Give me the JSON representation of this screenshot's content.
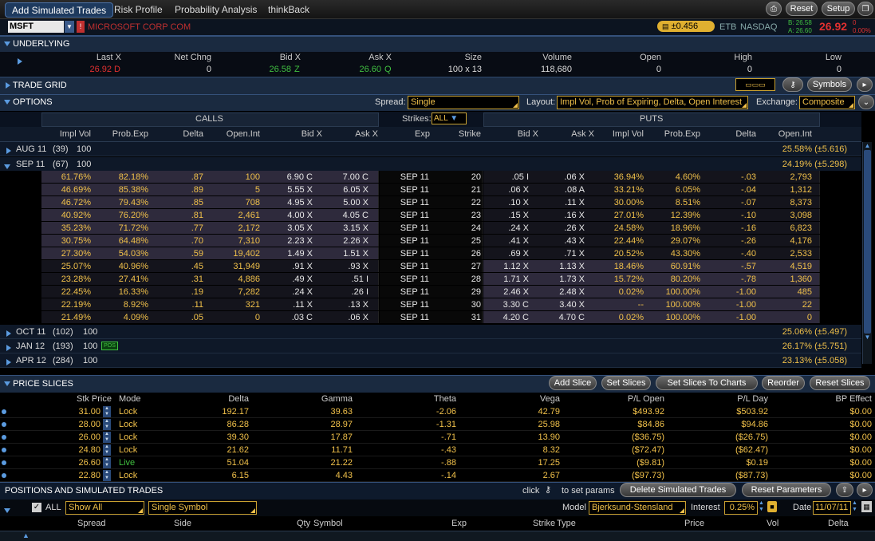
{
  "tabs": [
    "Add Simulated Trades",
    "Risk Profile",
    "Probability Analysis",
    "thinkBack"
  ],
  "top_buttons": {
    "reset": "Reset",
    "setup": "Setup"
  },
  "symbol": {
    "ticker": "MSFT",
    "company": "MICROSOFT CORP COM",
    "change": "±0.456",
    "etb": "ETB",
    "exchange": "NASDAQ",
    "bid_small": "B: 26.58",
    "ask_small": "A: 26.60",
    "last": "26.92",
    "chg_small": "0",
    "pct_small": "0.00%"
  },
  "underlying": {
    "title": "UNDERLYING",
    "headers": [
      "Last X",
      "Net Chng",
      "Bid X",
      "Ask X",
      "Size",
      "Volume",
      "Open",
      "High",
      "Low"
    ],
    "values": [
      "26.92",
      "0",
      "26.58",
      "26.60",
      "100 x 13",
      "118,680",
      "0",
      "0",
      "0"
    ],
    "last_ex": "D",
    "bid_ex": "Z",
    "ask_ex": "Q"
  },
  "trade_grid": {
    "title": "TRADE GRID",
    "symbols_label": "Symbols"
  },
  "options": {
    "title": "OPTIONS",
    "spread_label": "Spread:",
    "spread_value": "Single",
    "layout_label": "Layout:",
    "layout_value": "Impl Vol, Prob of Expiring, Delta, Open Interest",
    "exchange_label": "Exchange:",
    "exchange_value": "Composite",
    "calls_label": "CALLS",
    "puts_label": "PUTS",
    "strikes_label": "Strikes:",
    "strikes_value": "ALL",
    "headers": [
      "Impl Vol",
      "Prob.Exp",
      "Delta",
      "Open.Int",
      "Bid X",
      "Ask X",
      "Exp",
      "Strike",
      "Bid X",
      "Ask X",
      "Impl Vol",
      "Prob.Exp",
      "Delta",
      "Open.Int"
    ],
    "expiries": [
      {
        "name": "AUG 11",
        "days": "(39)",
        "mult": "100",
        "iv": "25.58% (±5.616)"
      },
      {
        "name": "SEP 11",
        "days": "(67)",
        "mult": "100",
        "iv": "24.19% (±5.298)"
      }
    ],
    "later_expiries": [
      {
        "name": "OCT 11",
        "days": "(102)",
        "mult": "100",
        "iv": "25.06% (±5.497)",
        "pos": ""
      },
      {
        "name": "JAN 12",
        "days": "(193)",
        "mult": "100",
        "iv": "26.17% (±5.751)",
        "pos": "POS"
      },
      {
        "name": "APR 12",
        "days": "(284)",
        "mult": "100",
        "iv": "23.13% (±5.058)",
        "pos": ""
      }
    ],
    "rows": [
      [
        "61.76%",
        "82.18%",
        ".87",
        "100",
        "6.90 C",
        "7.00 C",
        "SEP 11",
        "20",
        ".05 I",
        ".06 X",
        "36.94%",
        "4.60%",
        "-.03",
        "2,793"
      ],
      [
        "46.69%",
        "85.38%",
        ".89",
        "5",
        "5.55 X",
        "6.05 X",
        "SEP 11",
        "21",
        ".06 X",
        ".08 A",
        "33.21%",
        "6.05%",
        "-.04",
        "1,312"
      ],
      [
        "46.72%",
        "79.43%",
        ".85",
        "708",
        "4.95 X",
        "5.00 X",
        "SEP 11",
        "22",
        ".10 X",
        ".11 X",
        "30.00%",
        "8.51%",
        "-.07",
        "8,373"
      ],
      [
        "40.92%",
        "76.20%",
        ".81",
        "2,461",
        "4.00 X",
        "4.05 C",
        "SEP 11",
        "23",
        ".15 X",
        ".16 X",
        "27.01%",
        "12.39%",
        "-.10",
        "3,098"
      ],
      [
        "35.23%",
        "71.72%",
        ".77",
        "2,172",
        "3.05 X",
        "3.15 X",
        "SEP 11",
        "24",
        ".24 X",
        ".26 X",
        "24.58%",
        "18.96%",
        "-.16",
        "6,823"
      ],
      [
        "30.75%",
        "64.48%",
        ".70",
        "7,310",
        "2.23 X",
        "2.26 X",
        "SEP 11",
        "25",
        ".41 X",
        ".43 X",
        "22.44%",
        "29.07%",
        "-.26",
        "4,176"
      ],
      [
        "27.30%",
        "54.03%",
        ".59",
        "19,402",
        "1.49 X",
        "1.51 X",
        "SEP 11",
        "26",
        ".69 X",
        ".71 X",
        "20.52%",
        "43.30%",
        "-.40",
        "2,533"
      ],
      [
        "25.07%",
        "40.96%",
        ".45",
        "31,949",
        ".91 X",
        ".93 X",
        "SEP 11",
        "27",
        "1.12 X",
        "1.13 X",
        "18.46%",
        "60.91%",
        "-.57",
        "4,519"
      ],
      [
        "23.28%",
        "27.41%",
        ".31",
        "4,886",
        ".49 X",
        ".51 I",
        "SEP 11",
        "28",
        "1.71 X",
        "1.73 X",
        "15.72%",
        "80.20%",
        "-.78",
        "1,360"
      ],
      [
        "22.45%",
        "16.33%",
        ".19",
        "7,282",
        ".24 X",
        ".26 I",
        "SEP 11",
        "29",
        "2.46 X",
        "2.48 X",
        "0.02%",
        "100.00%",
        "-1.00",
        "485"
      ],
      [
        "22.19%",
        "8.92%",
        ".11",
        "321",
        ".11 X",
        ".13 X",
        "SEP 11",
        "30",
        "3.30 C",
        "3.40 X",
        "--",
        "100.00%",
        "-1.00",
        "22"
      ],
      [
        "21.49%",
        "4.09%",
        ".05",
        "0",
        ".03 C",
        ".06 X",
        "SEP 11",
        "31",
        "4.20 C",
        "4.70 C",
        "0.02%",
        "100.00%",
        "-1.00",
        "0"
      ]
    ]
  },
  "price_slices": {
    "title": "PRICE SLICES",
    "buttons": [
      "Add Slice",
      "Set Slices",
      "Set Slices To Charts",
      "Reorder",
      "Reset Slices"
    ],
    "headers": [
      "Stk Price",
      "Mode",
      "Delta",
      "Gamma",
      "Theta",
      "Vega",
      "P/L Open",
      "P/L Day",
      "BP Effect"
    ],
    "rows": [
      [
        "31.00",
        "Lock",
        "192.17",
        "39.63",
        "-2.06",
        "42.79",
        "$493.92",
        "$503.92",
        "$0.00"
      ],
      [
        "28.00",
        "Lock",
        "86.28",
        "28.97",
        "-1.31",
        "25.98",
        "$84.86",
        "$94.86",
        "$0.00"
      ],
      [
        "26.00",
        "Lock",
        "39.30",
        "17.87",
        "-.71",
        "13.90",
        "($36.75)",
        "($26.75)",
        "$0.00"
      ],
      [
        "24.80",
        "Lock",
        "21.62",
        "11.71",
        "-.43",
        "8.32",
        "($72.47)",
        "($62.47)",
        "$0.00"
      ],
      [
        "26.60",
        "Live",
        "51.04",
        "21.22",
        "-.88",
        "17.25",
        "($9.81)",
        "$0.19",
        "$0.00"
      ],
      [
        "22.80",
        "Lock",
        "6.15",
        "4.43",
        "-.14",
        "2.67",
        "($97.73)",
        "($87.73)",
        "$0.00"
      ]
    ]
  },
  "positions": {
    "title": "POSITIONS AND SIMULATED TRADES",
    "click_text": "click",
    "params_text": "to set params",
    "delete_btn": "Delete Simulated Trades",
    "reset_btn": "Reset Parameters",
    "all_label": "ALL",
    "show_value": "Show All",
    "symbol_value": "Single Symbol",
    "model_label": "Model",
    "model_value": "Bjerksund-Stensland",
    "interest_label": "Interest",
    "interest_value": "0.25%",
    "date_label": "Date",
    "date_value": "11/07/11",
    "headers": [
      "Spread",
      "Side",
      "Qty",
      "Symbol",
      "Exp",
      "Strike",
      "Type",
      "Price",
      "Vol",
      "Delta"
    ]
  },
  "colors": {
    "accent": "#f0c04a",
    "bar": "#1a2a40",
    "red": "#e03030",
    "green": "#40c040"
  }
}
